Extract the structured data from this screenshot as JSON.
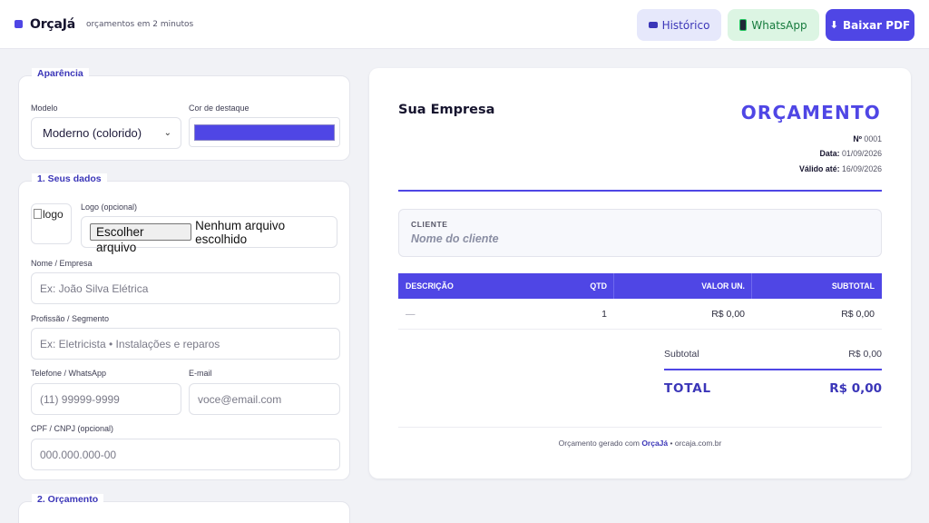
{
  "header": {
    "brand_name": "OrçaJá",
    "tagline": "orçamentos em 2 minutos",
    "history_label": "Histórico",
    "whatsapp_label": "WhatsApp",
    "download_label": "Baixar PDF",
    "accent_color": "#4f46e5"
  },
  "appearance": {
    "title": "Aparência",
    "model_label": "Modelo",
    "model_value": "Moderno (colorido)",
    "highlight_label": "Cor de destaque",
    "highlight_color": "#4f46e5"
  },
  "your_data": {
    "title": "1. Seus dados",
    "logo_alt": "logo",
    "logo_label": "Logo (opcional)",
    "file_button": "Escolher arquivo",
    "file_status": "Nenhum arquivo escolhido",
    "name_label": "Nome / Empresa",
    "name_placeholder": "Ex: João Silva Elétrica",
    "profession_label": "Profissão / Segmento",
    "profession_placeholder": "Ex: Eletricista • Instalações e reparos",
    "phone_label": "Telefone / WhatsApp",
    "phone_placeholder": "(11) 99999-9999",
    "email_label": "E-mail",
    "email_placeholder": "voce@email.com",
    "doc_label": "CPF / CNPJ (opcional)",
    "doc_placeholder": "000.000.000-00"
  },
  "quote_section": {
    "title": "2. Orçamento"
  },
  "preview": {
    "company": "Sua Empresa",
    "doc_title": "ORÇAMENTO",
    "number_label": "Nº",
    "number_value": "0001",
    "date_label": "Data:",
    "date_value": "01/09/2026",
    "valid_label": "Válido até:",
    "valid_value": "16/09/2026",
    "client_label": "CLIENTE",
    "client_placeholder": "Nome do cliente",
    "columns": [
      "DESCRIÇÃO",
      "QTD",
      "VALOR UN.",
      "SUBTOTAL"
    ],
    "rows": [
      {
        "description": "—",
        "qty": "1",
        "unit": "R$ 0,00",
        "subtotal": "R$ 0,00"
      }
    ],
    "subtotal_label": "Subtotal",
    "subtotal_value": "R$ 0,00",
    "total_label": "TOTAL",
    "total_value": "R$ 0,00",
    "footer_prefix": "Orçamento gerado com",
    "footer_brand": "OrçaJá",
    "footer_suffix": "• orcaja.com.br"
  }
}
